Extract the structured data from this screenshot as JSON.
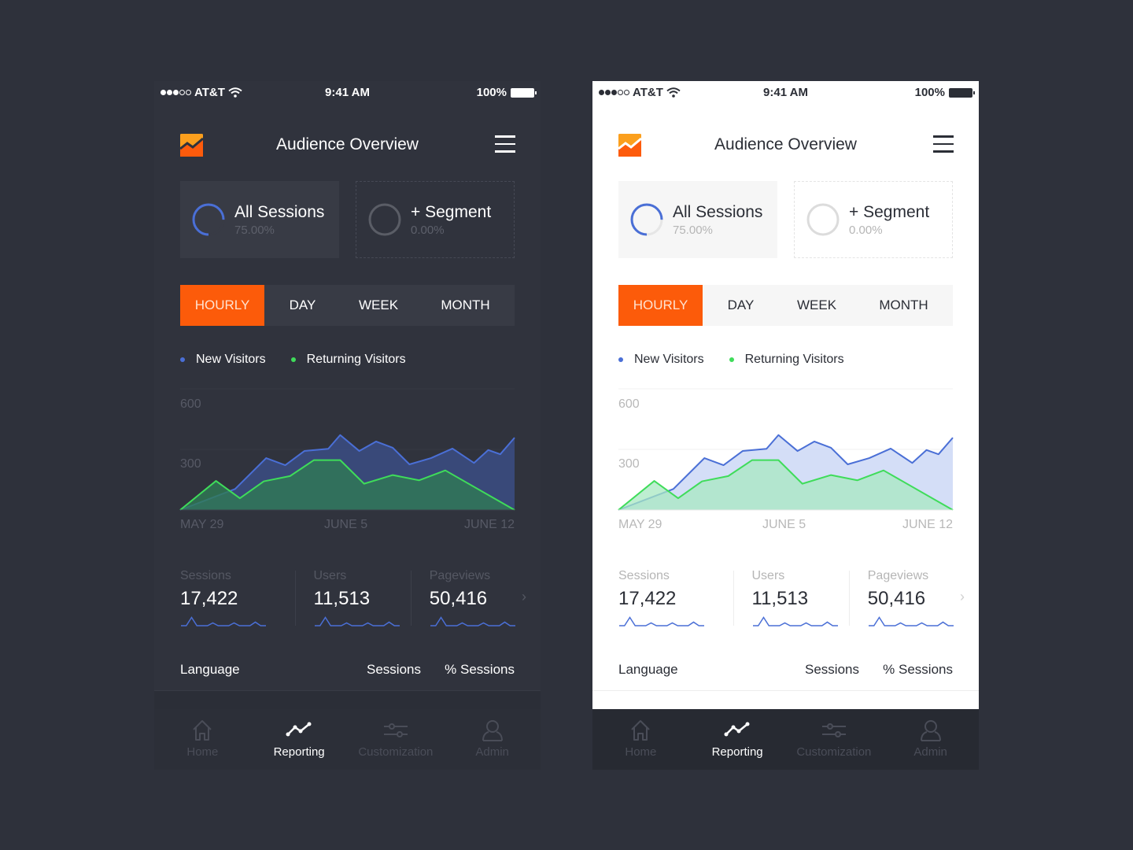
{
  "theme_colors": {
    "accent": "#fc5b0a",
    "new_visitors": "#4a6fd6",
    "returning_visitors": "#3fdc5a",
    "dark_bg": "#30333d",
    "light_bg": "#ffffff",
    "page_bg": "#2e313b"
  },
  "phones": [
    {
      "theme": "dark",
      "status": {
        "carrier": "AT&T",
        "time": "9:41 AM",
        "battery": "100%",
        "signal_bars_on": 3,
        "signal_bars_total": 5
      },
      "header": {
        "title": "Audience Overview",
        "logo_icon": "analytics-logo-icon",
        "menu_icon": "hamburger-menu-icon"
      },
      "segments": [
        {
          "name": "All Sessions",
          "percent": "75.00%",
          "ring_fill": 0.75
        },
        {
          "name": "+ Segment",
          "percent": "0.00%",
          "ring_fill": 0.0
        }
      ],
      "tabs": [
        "HOURLY",
        "DAY",
        "WEEK",
        "MONTH"
      ],
      "active_tab": "HOURLY",
      "legend": [
        "New Visitors",
        "Returning Visitors"
      ],
      "stats": [
        {
          "label": "Sessions",
          "value": "17,422"
        },
        {
          "label": "Users",
          "value": "11,513"
        },
        {
          "label": "Pageviews",
          "value": "50,416"
        }
      ],
      "more_icon": "chevron-right-icon",
      "table_header": {
        "col1": "Language",
        "col2": "Sessions",
        "col3": "% Sessions"
      },
      "nav": [
        {
          "label": "Home",
          "icon": "home-icon"
        },
        {
          "label": "Reporting",
          "icon": "line-chart-icon",
          "active": true
        },
        {
          "label": "Customization",
          "icon": "sliders-icon"
        },
        {
          "label": "Admin",
          "icon": "user-icon"
        }
      ]
    },
    {
      "theme": "light",
      "status": {
        "carrier": "AT&T",
        "time": "9:41 AM",
        "battery": "100%",
        "signal_bars_on": 3,
        "signal_bars_total": 5
      },
      "header": {
        "title": "Audience Overview",
        "logo_icon": "analytics-logo-icon",
        "menu_icon": "hamburger-menu-icon"
      },
      "segments": [
        {
          "name": "All Sessions",
          "percent": "75.00%",
          "ring_fill": 0.75
        },
        {
          "name": "+ Segment",
          "percent": "0.00%",
          "ring_fill": 0.0
        }
      ],
      "tabs": [
        "HOURLY",
        "DAY",
        "WEEK",
        "MONTH"
      ],
      "active_tab": "HOURLY",
      "legend": [
        "New Visitors",
        "Returning Visitors"
      ],
      "stats": [
        {
          "label": "Sessions",
          "value": "17,422"
        },
        {
          "label": "Users",
          "value": "11,513"
        },
        {
          "label": "Pageviews",
          "value": "50,416"
        }
      ],
      "more_icon": "chevron-right-icon",
      "table_header": {
        "col1": "Language",
        "col2": "Sessions",
        "col3": "% Sessions"
      },
      "nav": [
        {
          "label": "Home",
          "icon": "home-icon"
        },
        {
          "label": "Reporting",
          "icon": "line-chart-icon",
          "active": true
        },
        {
          "label": "Customization",
          "icon": "sliders-icon"
        },
        {
          "label": "Admin",
          "icon": "user-icon"
        }
      ]
    }
  ],
  "chart_data": {
    "type": "area",
    "title": "",
    "xlabel": "",
    "ylabel": "",
    "x_range": [
      0,
      14
    ],
    "ylim": [
      0,
      600
    ],
    "yticks": [
      300,
      600
    ],
    "ytick_labels": [
      "300",
      "600"
    ],
    "xtick_positions": [
      0,
      7,
      14
    ],
    "xtick_labels": [
      "MAY 29",
      "JUNE 5",
      "JUNE 12"
    ],
    "grid": true,
    "legend_position": "top-left",
    "series": [
      {
        "name": "New Visitors",
        "color": "#4a6fd6",
        "x": [
          0,
          2.3,
          3.6,
          4.4,
          5.2,
          6.2,
          6.7,
          7.5,
          8.2,
          8.9,
          9.6,
          10.5,
          11.4,
          12.3,
          12.9,
          13.4,
          14
        ],
        "values": [
          0,
          104,
          257,
          222,
          292,
          303,
          371,
          292,
          339,
          308,
          226,
          257,
          304,
          233,
          297,
          276,
          358
        ]
      },
      {
        "name": "Returning Visitors",
        "color": "#3fdc5a",
        "x": [
          0,
          1.5,
          2.5,
          3.5,
          4.6,
          5.6,
          6.7,
          7.7,
          8.9,
          10.0,
          11.1,
          14
        ],
        "values": [
          0,
          144,
          58,
          142,
          168,
          247,
          247,
          130,
          173,
          147,
          196,
          0
        ]
      }
    ],
    "sparkline": [
      0,
      0,
      3,
      0,
      0,
      0,
      1,
      0,
      0,
      0,
      1,
      0,
      0,
      0,
      1.3,
      0,
      0
    ]
  }
}
